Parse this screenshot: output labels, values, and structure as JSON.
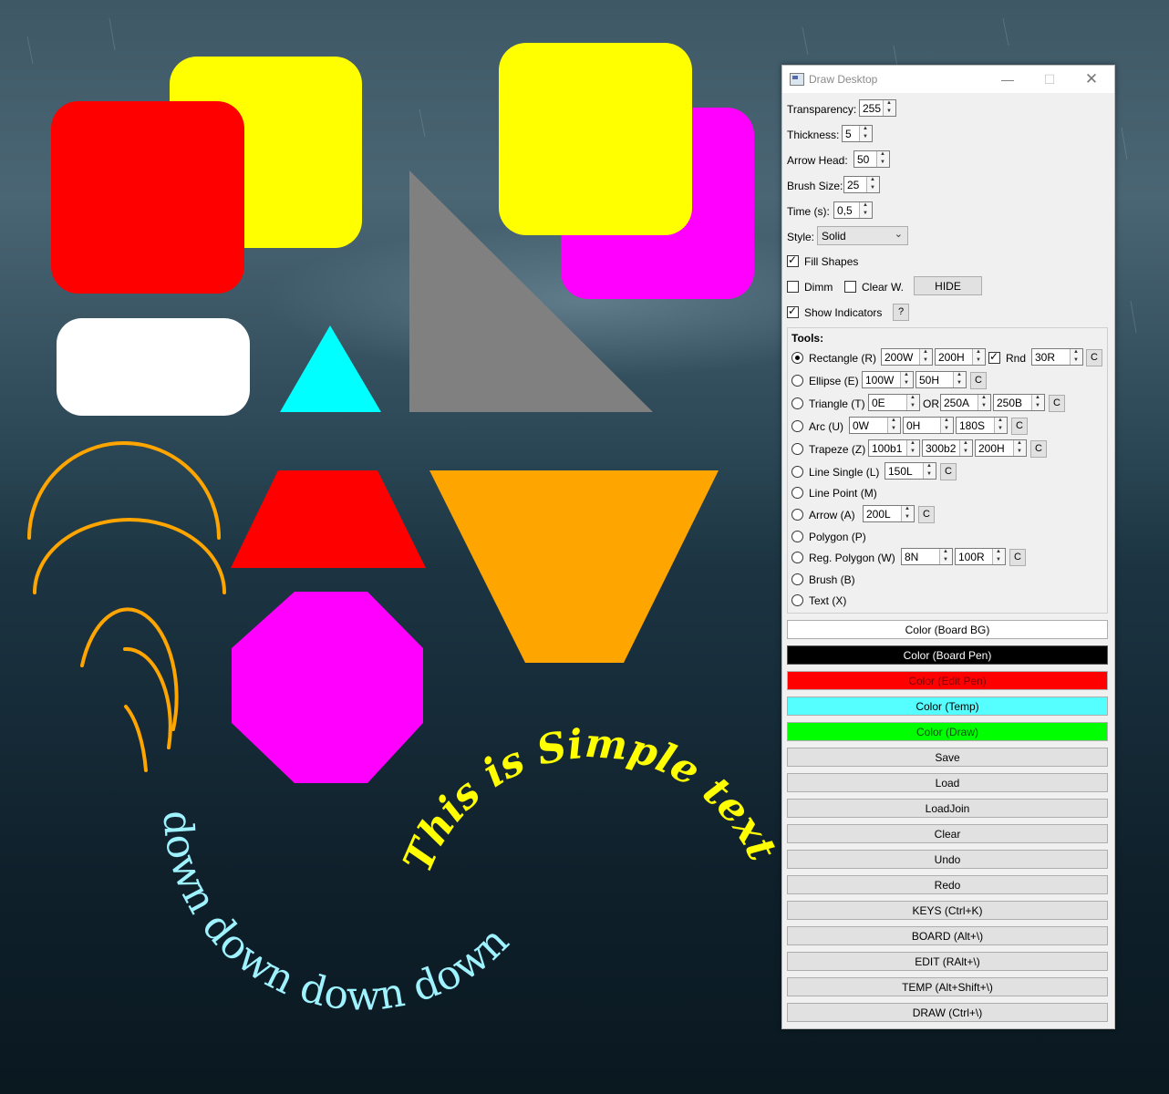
{
  "window": {
    "title": "Draw Desktop",
    "minimize_icon": "minimize-icon",
    "maximize_icon": "maximize-icon",
    "close_icon": "close-icon"
  },
  "settings": {
    "transparency_label": "Transparency:",
    "transparency": "255",
    "thickness_label": "Thickness:",
    "thickness": "5",
    "arrow_head_label": "Arrow Head:",
    "arrow_head": "50",
    "brush_size_label": "Brush Size:",
    "brush_size": "25",
    "time_label": "Time (s):",
    "time": "0,5",
    "style_label": "Style:",
    "style": "Solid",
    "fill_shapes_label": "Fill Shapes",
    "fill_shapes": true,
    "dimm_label": "Dimm",
    "dimm": false,
    "clear_w_label": "Clear W.",
    "clear_w": false,
    "hide_button": "HIDE",
    "show_indicators_label": "Show Indicators",
    "show_indicators": true,
    "help_button": "?"
  },
  "tools": {
    "title": "Tools:",
    "selected": "Rectangle (R)",
    "c_label": "C",
    "or_label": "OR",
    "rnd_label": "Rnd",
    "rectangle": {
      "label": "Rectangle (R)",
      "w": "200W",
      "h": "200H",
      "rnd_checked": true,
      "r": "30R"
    },
    "ellipse": {
      "label": "Ellipse (E)",
      "w": "100W",
      "h": "50H"
    },
    "triangle": {
      "label": "Triangle (T)",
      "e": "0E",
      "a": "250A",
      "b": "250B"
    },
    "arc": {
      "label": "Arc (U)",
      "w": "0W",
      "h": "0H",
      "s": "180S"
    },
    "trapeze": {
      "label": "Trapeze (Z)",
      "b1": "100b1",
      "b2": "300b2",
      "h": "200H"
    },
    "line_single": {
      "label": "Line Single (L)",
      "l": "150L"
    },
    "line_point": {
      "label": "Line Point (M)"
    },
    "arrow": {
      "label": "Arrow (A)",
      "l": "200L"
    },
    "polygon": {
      "label": "Polygon (P)"
    },
    "reg_polygon": {
      "label": "Reg. Polygon (W)",
      "n": "8N",
      "r": "100R"
    },
    "brush": {
      "label": "Brush (B)"
    },
    "text": {
      "label": "Text (X)"
    }
  },
  "colors": {
    "board_bg": {
      "label": "Color (Board BG)",
      "bg": "#ffffff",
      "fg": "#000000"
    },
    "board_pen": {
      "label": "Color (Board Pen)",
      "bg": "#000000",
      "fg": "#ffffff"
    },
    "edit_pen": {
      "label": "Color (Edit Pen)",
      "bg": "#ff0000",
      "fg": "#7a0000"
    },
    "temp": {
      "label": "Color (Temp)",
      "bg": "#55ffff",
      "fg": "#000000"
    },
    "draw": {
      "label": "Color (Draw)",
      "bg": "#00ff00",
      "fg": "#005500"
    }
  },
  "actions": {
    "save": "Save",
    "load": "Load",
    "loadjoin": "LoadJoin",
    "clear": "Clear",
    "undo": "Undo",
    "redo": "Redo",
    "keys": "KEYS (Ctrl+K)",
    "board": "BOARD (Alt+\\)",
    "edit": "EDIT (RAlt+\\)",
    "temp": "TEMP (Alt+Shift+\\)",
    "draw": "DRAW (Ctrl+\\)"
  },
  "canvas_text": {
    "curved_yellow": "This is Simple text",
    "curved_cyan": "down down down down"
  },
  "shape_colors": {
    "yellow": "#ffff00",
    "red": "#ff0000",
    "magenta": "#ff00ff",
    "white": "#ffffff",
    "cyan": "#00ffff",
    "gray": "#808080",
    "orange": "#ffa500",
    "text_cyan": "#9ff3ff"
  }
}
